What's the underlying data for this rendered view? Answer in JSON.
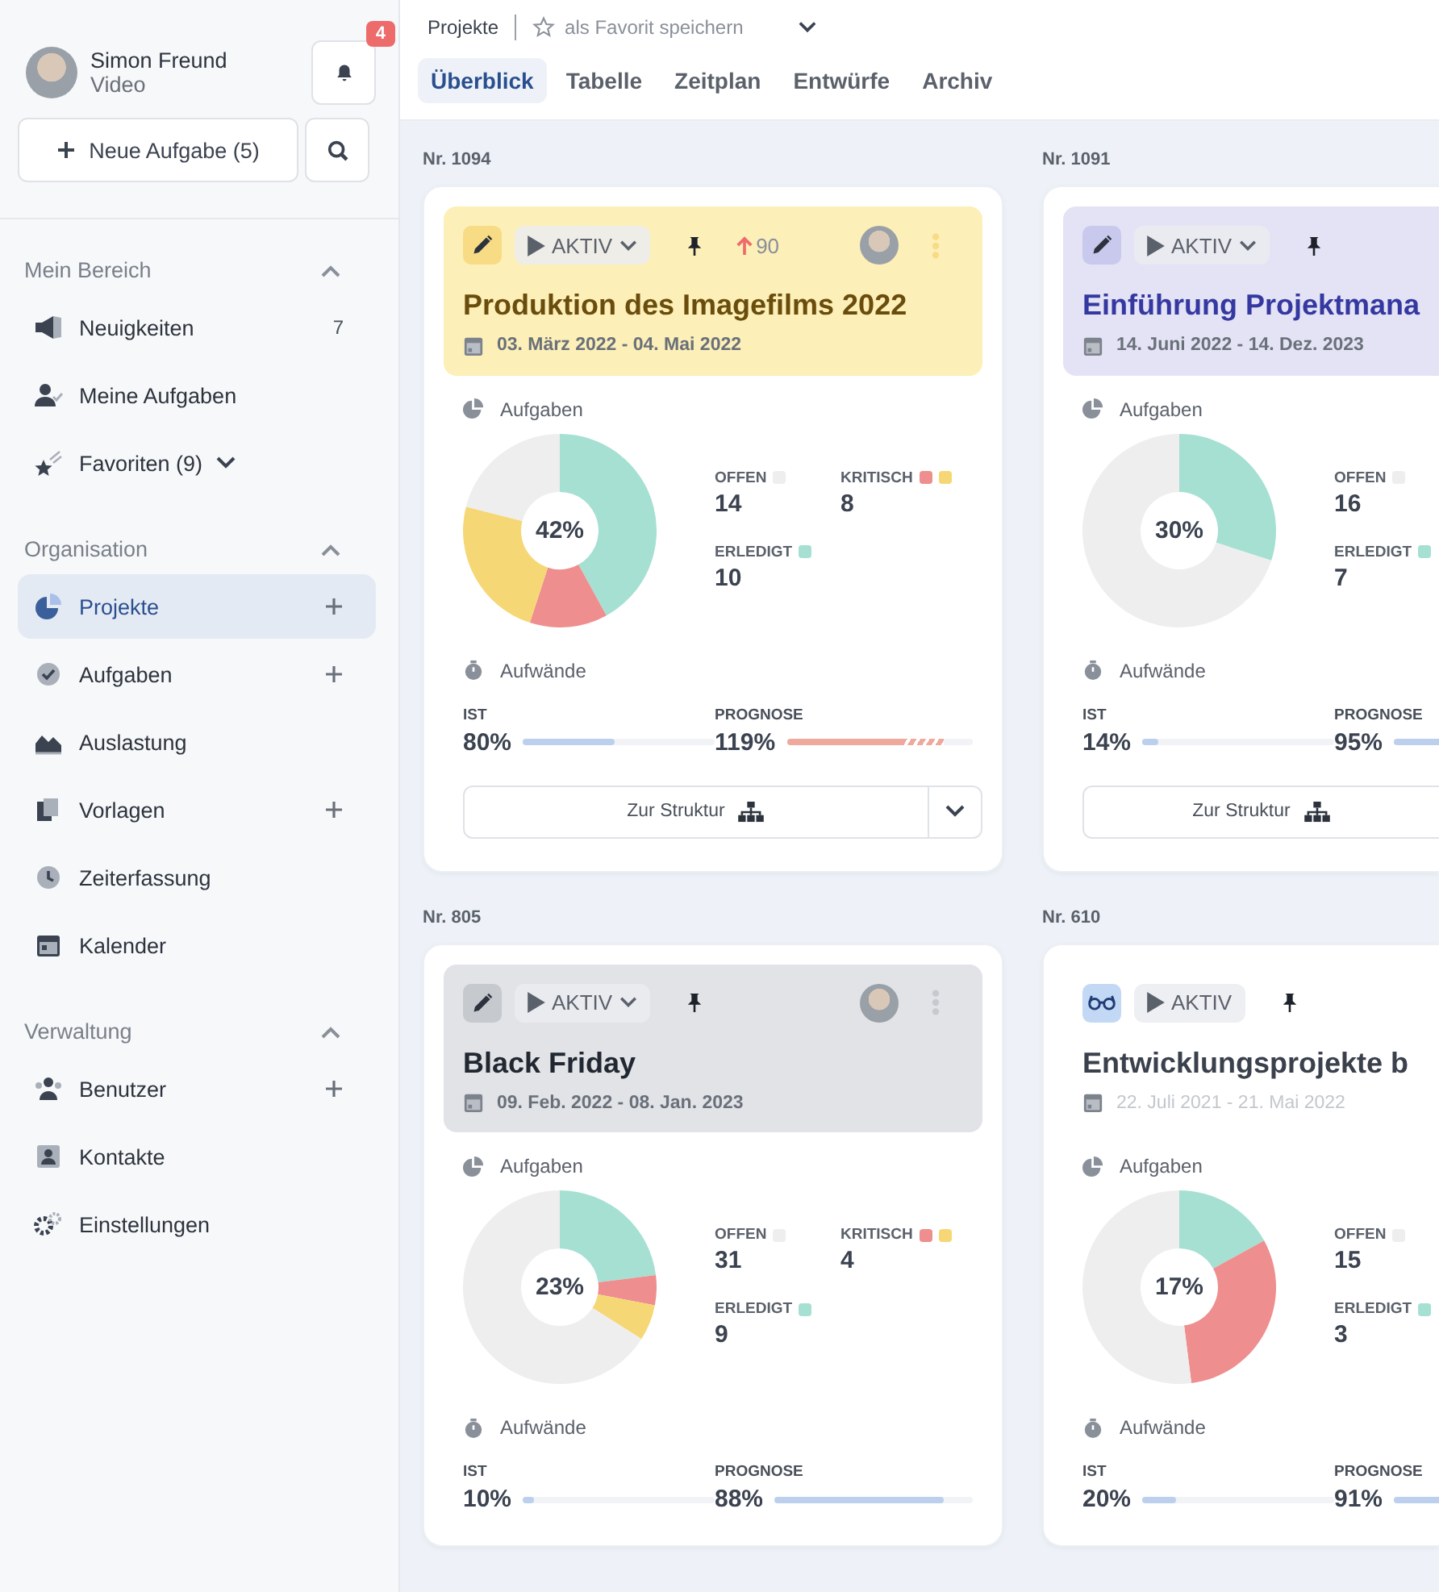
{
  "user": {
    "name": "Simon Freund",
    "role": "Video"
  },
  "notifications": {
    "badge": "4"
  },
  "new_task_button": "Neue Aufgabe (5)",
  "sidebar": {
    "sections": [
      {
        "title": "Mein Bereich",
        "expanded": true,
        "items": [
          {
            "label": "Neuigkeiten",
            "count": "7",
            "selected": false,
            "add": false,
            "dropdown": false
          },
          {
            "label": "Meine Aufgaben",
            "selected": false,
            "add": false,
            "dropdown": false
          },
          {
            "label": "Favoriten (9)",
            "selected": false,
            "add": false,
            "dropdown": true
          }
        ]
      },
      {
        "title": "Organisation",
        "expanded": true,
        "items": [
          {
            "label": "Projekte",
            "selected": true,
            "add": true,
            "dropdown": false
          },
          {
            "label": "Aufgaben",
            "selected": false,
            "add": true,
            "dropdown": false
          },
          {
            "label": "Auslastung",
            "selected": false,
            "add": false,
            "dropdown": false
          },
          {
            "label": "Vorlagen",
            "selected": false,
            "add": true,
            "dropdown": false
          },
          {
            "label": "Zeiterfassung",
            "selected": false,
            "add": false,
            "dropdown": false
          },
          {
            "label": "Kalender",
            "selected": false,
            "add": false,
            "dropdown": false
          }
        ]
      },
      {
        "title": "Verwaltung",
        "expanded": true,
        "items": [
          {
            "label": "Benutzer",
            "selected": false,
            "add": true,
            "dropdown": false
          },
          {
            "label": "Kontakte",
            "selected": false,
            "add": false,
            "dropdown": false
          },
          {
            "label": "Einstellungen",
            "selected": false,
            "add": false,
            "dropdown": false
          }
        ]
      }
    ]
  },
  "breadcrumb": {
    "title": "Projekte",
    "favorite": "als Favorit speichern"
  },
  "tabs": [
    {
      "label": "Überblick",
      "selected": true
    },
    {
      "label": "Tabelle",
      "selected": false
    },
    {
      "label": "Zeitplan",
      "selected": false
    },
    {
      "label": "Entwürfe",
      "selected": false
    },
    {
      "label": "Archiv",
      "selected": false
    }
  ],
  "cards": [
    {
      "number": "Nr. 1094",
      "color": "#fcefb8",
      "mode_button": {
        "kind": "edit",
        "color": "#f7dc85"
      },
      "status": {
        "label": "AKTIV",
        "dropdown": true
      },
      "pinned": true,
      "priority": "90",
      "avatar": true,
      "menu": true,
      "title": {
        "text": "Produktion des Imagefilms 2022",
        "color": "#6a4d0c"
      },
      "dates": "03. März 2022 - 04. Mai 2022",
      "dates_muted": false,
      "tasks_label": "Aufgaben",
      "chart_data": {
        "type": "donut",
        "values": [
          42,
          13,
          24,
          21
        ]
      },
      "percent": "42%",
      "legend": [
        {
          "kind": "open",
          "label": "OFFEN",
          "value": "14",
          "swatches": [
            {
              "color": "#eeeeef"
            }
          ]
        },
        {
          "kind": "critical",
          "label": "KRITISCH",
          "value": "8",
          "swatches": [
            {
              "color": "#ee8e8e"
            },
            {
              "color": "#f6d775"
            }
          ]
        },
        {
          "kind": "done",
          "label": "ERLEDIGT",
          "value": "10",
          "swatches": [
            {
              "color": "#a6e0d3"
            }
          ]
        }
      ],
      "effort_label": "Aufwände",
      "actual": {
        "label": "IST",
        "value": "80%",
        "level": 0.48,
        "overrun": false
      },
      "forecast": {
        "label": "PROGNOSE",
        "value": "119%",
        "level": 0.62,
        "overrun": true
      },
      "structure_button": "Zur Struktur",
      "structure_dropdown": true
    },
    {
      "number": "Nr. 1091",
      "color": "#e3e3f5",
      "mode_button": {
        "kind": "edit",
        "color": "#c9c9ee"
      },
      "status": {
        "label": "AKTIV",
        "dropdown": true
      },
      "pinned": true,
      "title": {
        "text": "Einführung Projektmana",
        "color": "#3538a0"
      },
      "dates": "14. Juni 2022 - 14. Dez. 2023",
      "dates_muted": false,
      "tasks_label": "Aufgaben",
      "chart_data": {
        "type": "donut",
        "values": [
          30,
          0,
          0,
          70
        ]
      },
      "percent": "30%",
      "legend": [
        {
          "kind": "open",
          "label": "OFFEN",
          "value": "16",
          "swatches": [
            {
              "color": "#eeeeef"
            }
          ]
        },
        {
          "kind": "done",
          "label": "ERLEDIGT",
          "value": "7",
          "swatches": [
            {
              "color": "#a6e0d3"
            }
          ]
        }
      ],
      "effort_label": "Aufwände",
      "actual": {
        "label": "IST",
        "value": "14%",
        "level": 0.08,
        "overrun": false
      },
      "forecast": {
        "label": "PROGNOSE",
        "value": "95%",
        "level": 0.6,
        "overrun": false
      },
      "structure_button": "Zur Struktur"
    },
    {
      "number": "Nr. 805",
      "color": "#e1e3e7",
      "mode_button": {
        "kind": "edit",
        "color": "#c6c9ce"
      },
      "status": {
        "label": "AKTIV",
        "dropdown": true
      },
      "pinned": true,
      "avatar": true,
      "menu": true,
      "title": {
        "text": "Black Friday",
        "color": "#222831"
      },
      "dates": "09. Feb. 2022 - 08. Jan. 2023",
      "dates_muted": false,
      "tasks_label": "Aufgaben",
      "chart_data": {
        "type": "donut",
        "values": [
          23,
          5,
          6,
          66
        ]
      },
      "percent": "23%",
      "legend": [
        {
          "kind": "open",
          "label": "OFFEN",
          "value": "31",
          "swatches": [
            {
              "color": "#eeeeef"
            }
          ]
        },
        {
          "kind": "critical",
          "label": "KRITISCH",
          "value": "4",
          "swatches": [
            {
              "color": "#ee8e8e"
            },
            {
              "color": "#f6d775"
            }
          ]
        },
        {
          "kind": "done",
          "label": "ERLEDIGT",
          "value": "9",
          "swatches": [
            {
              "color": "#a6e0d3"
            }
          ]
        }
      ],
      "effort_label": "Aufwände",
      "actual": {
        "label": "IST",
        "value": "10%",
        "level": 0.06,
        "overrun": false
      },
      "forecast": {
        "label": "PROGNOSE",
        "value": "88%",
        "level": 0.85,
        "overrun": false
      }
    },
    {
      "number": "Nr. 610",
      "color": "#ffffff",
      "mode_button": {
        "kind": "view",
        "color": "#c3d8f5"
      },
      "status": {
        "label": "AKTIV",
        "dropdown": false
      },
      "pinned": true,
      "title": {
        "text": "Entwicklungsprojekte b",
        "color": "#3a414c"
      },
      "dates": "22. Juli 2021 - 21. Mai 2022",
      "dates_muted": true,
      "tasks_label": "Aufgaben",
      "chart_data": {
        "type": "donut",
        "values": [
          17,
          31,
          0,
          52
        ]
      },
      "percent": "17%",
      "legend": [
        {
          "kind": "open",
          "label": "OFFEN",
          "value": "15",
          "swatches": [
            {
              "color": "#eeeeef"
            }
          ]
        },
        {
          "kind": "done",
          "label": "ERLEDIGT",
          "value": "3",
          "swatches": [
            {
              "color": "#a6e0d3"
            }
          ]
        }
      ],
      "effort_label": "Aufwände",
      "actual": {
        "label": "IST",
        "value": "20%",
        "level": 0.18,
        "overrun": false
      },
      "forecast": {
        "label": "PROGNOSE",
        "value": "91%",
        "level": 0.6,
        "overrun": false
      }
    }
  ]
}
